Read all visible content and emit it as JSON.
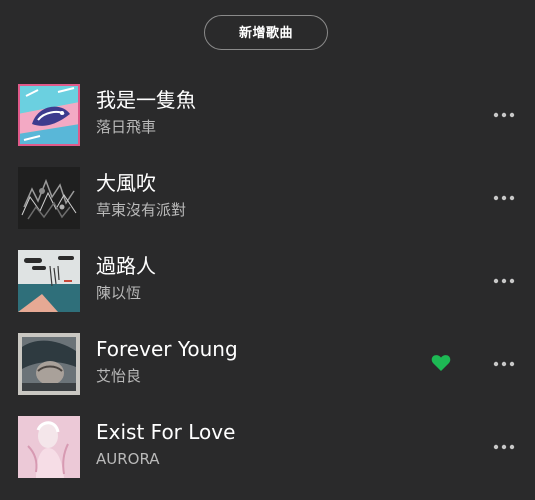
{
  "actions": {
    "add_song_label": "新增歌曲"
  },
  "accent_color": "#1db954",
  "tracks": [
    {
      "title": "我是一隻魚",
      "artist": "落日飛車",
      "liked": false,
      "cover": "colorful-fish-illustration"
    },
    {
      "title": "大風吹",
      "artist": "草東沒有派對",
      "liked": false,
      "cover": "dark-sketch-artwork"
    },
    {
      "title": "過路人",
      "artist": "陳以恆",
      "liked": false,
      "cover": "clouds-calligraphy-artwork"
    },
    {
      "title": "Forever Young",
      "artist": "艾怡良",
      "liked": true,
      "cover": "portrait-photo"
    },
    {
      "title": "Exist For Love",
      "artist": "AURORA",
      "liked": false,
      "cover": "pink-portrait-photo"
    }
  ]
}
